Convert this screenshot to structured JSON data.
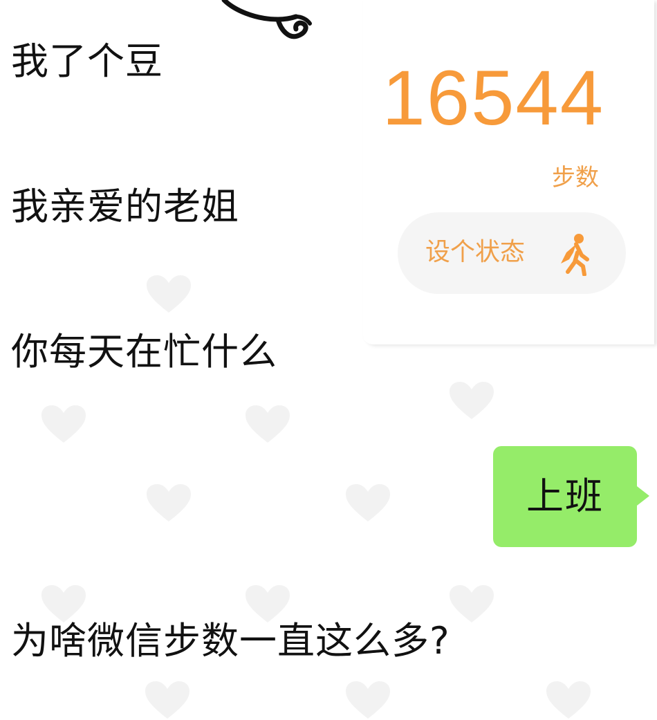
{
  "chat": {
    "received": [
      {
        "text": "我了个豆"
      },
      {
        "text": "我亲爱的老姐"
      },
      {
        "text": "你每天在忙什么"
      },
      {
        "text": "为啥微信步数一直这么多?"
      }
    ],
    "sent": [
      {
        "text": "上班"
      }
    ]
  },
  "step_card": {
    "count": "16544",
    "label": "步数",
    "status_button": "设个状态",
    "status_icon": "running-person-icon"
  },
  "colors": {
    "accent_orange": "#f79a3a",
    "sent_bubble": "#95ec69",
    "background": "#ffffff"
  }
}
